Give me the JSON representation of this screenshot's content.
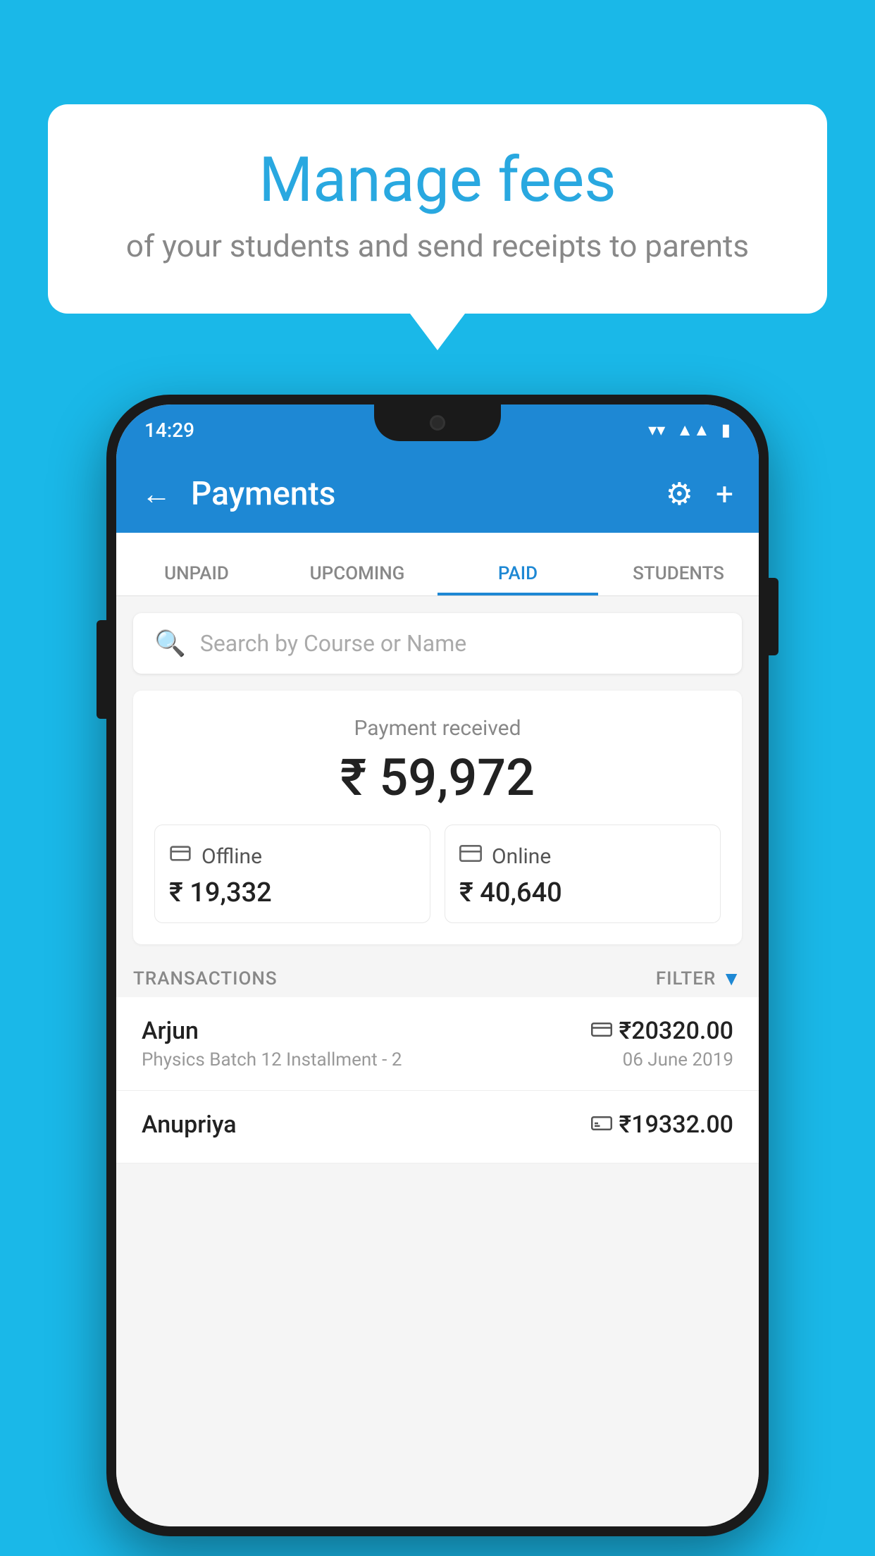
{
  "background_color": "#1ab8e8",
  "speech_bubble": {
    "title": "Manage fees",
    "subtitle": "of your students and send receipts to parents"
  },
  "status_bar": {
    "time": "14:29",
    "wifi_icon": "▾",
    "signal_icon": "◂",
    "battery_icon": "▮"
  },
  "app_bar": {
    "back_label": "←",
    "title": "Payments",
    "gear_icon": "⚙",
    "plus_icon": "+"
  },
  "tabs": [
    {
      "label": "UNPAID",
      "active": false
    },
    {
      "label": "UPCOMING",
      "active": false
    },
    {
      "label": "PAID",
      "active": true
    },
    {
      "label": "STUDENTS",
      "active": false
    }
  ],
  "search": {
    "placeholder": "Search by Course or Name",
    "icon": "🔍"
  },
  "payment_summary": {
    "label": "Payment received",
    "amount": "₹ 59,972",
    "offline": {
      "label": "Offline",
      "amount": "₹ 19,332",
      "icon": "💳"
    },
    "online": {
      "label": "Online",
      "amount": "₹ 40,640",
      "icon": "💳"
    }
  },
  "transactions": {
    "label": "TRANSACTIONS",
    "filter_label": "FILTER",
    "items": [
      {
        "name": "Arjun",
        "desc": "Physics Batch 12 Installment - 2",
        "amount": "₹20320.00",
        "date": "06 June 2019",
        "type_icon": "card"
      },
      {
        "name": "Anupriya",
        "desc": "",
        "amount": "₹19332.00",
        "date": "",
        "type_icon": "cash"
      }
    ]
  }
}
